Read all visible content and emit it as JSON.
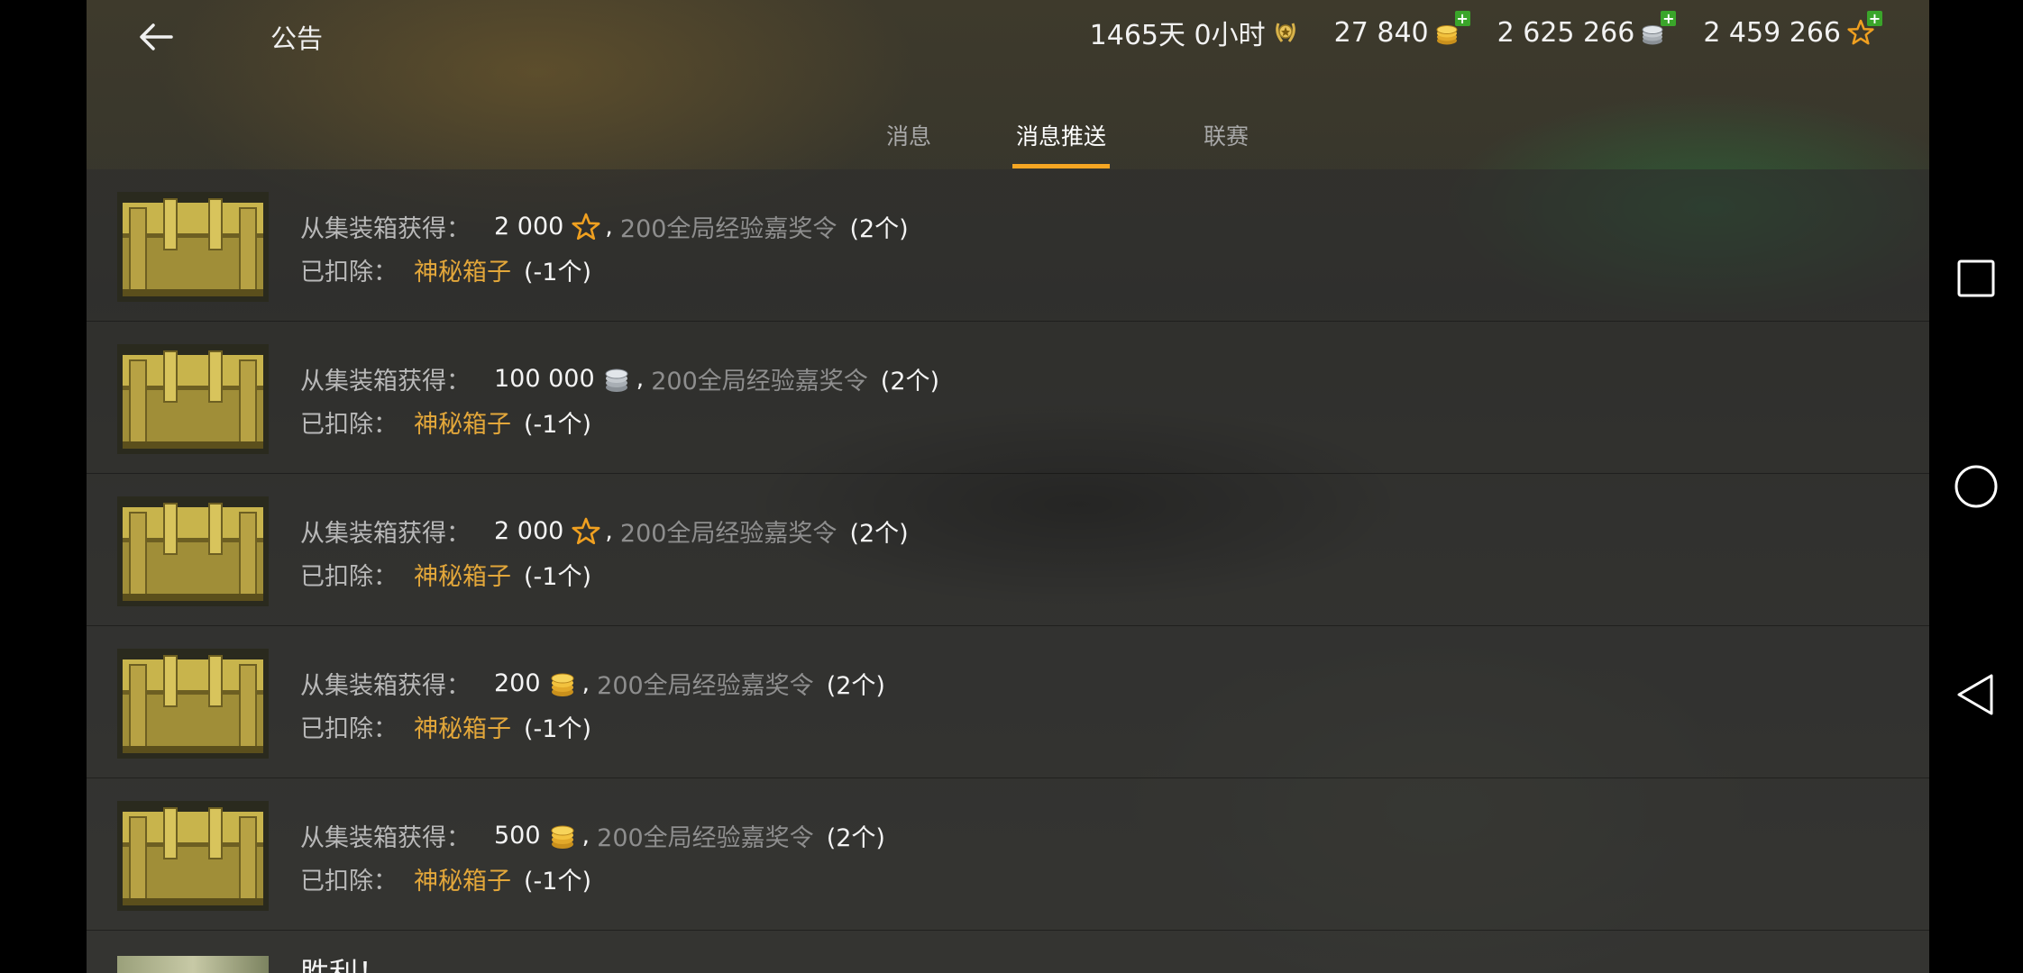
{
  "header": {
    "title": "公告",
    "resources": [
      {
        "value": "1465天 0小时",
        "icon": "premium-laurel-icon",
        "has_plus": false
      },
      {
        "value": "27 840",
        "icon": "gold-coins-icon",
        "has_plus": true
      },
      {
        "value": "2 625 266",
        "icon": "silver-coins-icon",
        "has_plus": true
      },
      {
        "value": "2 459 266",
        "icon": "free-xp-star-icon",
        "has_plus": true
      }
    ]
  },
  "tabs": [
    {
      "label": "消息",
      "active": false
    },
    {
      "label": "消息推送",
      "active": true
    },
    {
      "label": "联赛",
      "active": false
    }
  ],
  "messages": [
    {
      "received_label": "从集装箱获得：",
      "amount": "2 000",
      "currency": "star",
      "item": "200全局经验嘉奖令",
      "count": "(2个)",
      "deducted_label": "已扣除：",
      "deducted_item": "神秘箱子",
      "deducted_count": "(-1个)"
    },
    {
      "received_label": "从集装箱获得：",
      "amount": "100 000",
      "currency": "silver",
      "item": "200全局经验嘉奖令",
      "count": "(2个)",
      "deducted_label": "已扣除：",
      "deducted_item": "神秘箱子",
      "deducted_count": "(-1个)"
    },
    {
      "received_label": "从集装箱获得：",
      "amount": "2 000",
      "currency": "star",
      "item": "200全局经验嘉奖令",
      "count": "(2个)",
      "deducted_label": "已扣除：",
      "deducted_item": "神秘箱子",
      "deducted_count": "(-1个)"
    },
    {
      "received_label": "从集装箱获得：",
      "amount": "200",
      "currency": "gold",
      "item": "200全局经验嘉奖令",
      "count": "(2个)",
      "deducted_label": "已扣除：",
      "deducted_item": "神秘箱子",
      "deducted_count": "(-1个)"
    },
    {
      "received_label": "从集装箱获得：",
      "amount": "500",
      "currency": "gold",
      "item": "200全局经验嘉奖令",
      "count": "(2个)",
      "deducted_label": "已扣除：",
      "deducted_item": "神秘箱子",
      "deducted_count": "(-1个)"
    }
  ],
  "partial_message": {
    "title": "胜利！"
  },
  "comma": ",",
  "colors": {
    "accent": "#f5a623",
    "highlight_item": "#e3a73a",
    "plus_badge": "#3aa52a",
    "shop_banner": "#2f8f3a"
  }
}
